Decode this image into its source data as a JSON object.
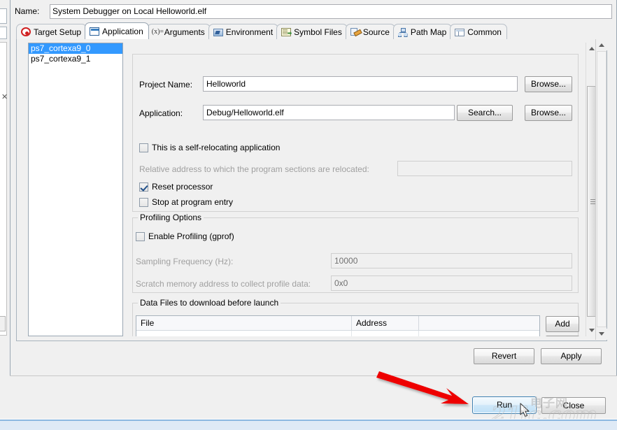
{
  "dialog": {
    "name_label": "Name:",
    "name_value": "System Debugger on Local Helloworld.elf"
  },
  "tabs": [
    {
      "label": "Target Setup",
      "icon": "target-icon",
      "active": false
    },
    {
      "label": "Application",
      "icon": "application-window-icon",
      "active": true
    },
    {
      "label": "Arguments",
      "icon": "variable-icon",
      "active": false
    },
    {
      "label": "Environment",
      "icon": "environment-icon",
      "active": false
    },
    {
      "label": "Symbol Files",
      "icon": "symbol-files-icon",
      "active": false
    },
    {
      "label": "Source",
      "icon": "source-pencil-icon",
      "active": false
    },
    {
      "label": "Path Map",
      "icon": "path-map-icon",
      "active": false
    },
    {
      "label": "Common",
      "icon": "common-icon",
      "active": false
    }
  ],
  "cpu_list": {
    "items": [
      {
        "label": "ps7_cortexa9_0",
        "selected": true
      },
      {
        "label": "ps7_cortexa9_1",
        "selected": false
      }
    ]
  },
  "application": {
    "project_name_label": "Project Name:",
    "project_name_value": "Helloworld",
    "project_browse_label": "Browse...",
    "application_label": "Application:",
    "application_value": "Debug/Helloworld.elf",
    "application_search_label": "Search...",
    "application_browse_label": "Browse...",
    "self_relocating_label": "This is a self-relocating application",
    "self_relocating_checked": false,
    "relative_address_label": "Relative address to which the program sections are relocated:",
    "relative_address_value": "",
    "reset_processor_label": "Reset processor",
    "reset_processor_checked": true,
    "stop_at_entry_label": "Stop at program entry",
    "stop_at_entry_checked": false
  },
  "profiling": {
    "group_label": "Profiling Options",
    "enable_label": "Enable Profiling (gprof)",
    "enable_checked": false,
    "sampling_label": "Sampling Frequency (Hz):",
    "sampling_value": "10000",
    "scratch_label": "Scratch memory address to collect profile data:",
    "scratch_value": "0x0"
  },
  "data_files": {
    "group_label": "Data Files to download before launch",
    "columns": [
      "File",
      "Address",
      ""
    ],
    "rows": [],
    "add_label": "Add"
  },
  "buttons": {
    "revert": "Revert",
    "apply": "Apply",
    "run": "Run",
    "close": "Close"
  },
  "annotation": {
    "arrow_color": "#ee0000"
  },
  "watermark": {
    "text_cn": "电子网",
    "text_en": "21ic.com"
  },
  "colors": {
    "selection_blue": "#3399ff",
    "default_button_border": "#3c7fb1",
    "dialog_bg": "#f0f0f0",
    "field_bg": "#ffffff"
  }
}
